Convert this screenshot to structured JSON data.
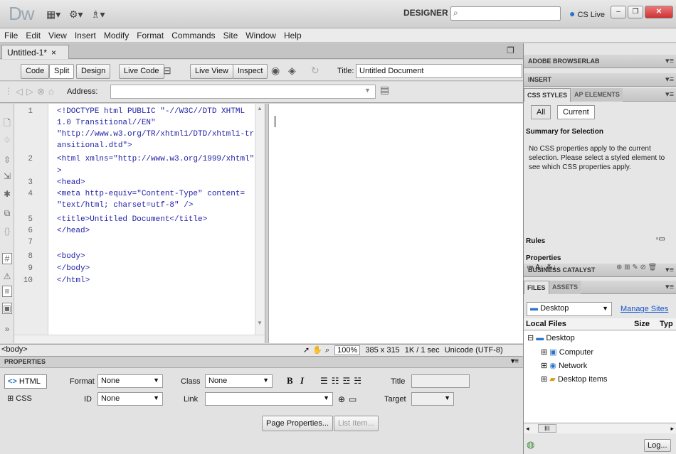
{
  "app": {
    "logo": "Dw",
    "workspace": "DESIGNER ▾",
    "cslive": "CS Live",
    "search_placeholder": "",
    "toolbar_icons": [
      "▦▾",
      "⚙▾",
      "♗▾"
    ]
  },
  "window_controls": {
    "minimize": "–",
    "maximize": "❐",
    "close": "✕"
  },
  "menu": [
    "File",
    "Edit",
    "View",
    "Insert",
    "Modify",
    "Format",
    "Commands",
    "Site",
    "Window",
    "Help"
  ],
  "document_tab": {
    "label": "Untitled-1*",
    "close": "×"
  },
  "view_buttons": {
    "code": "Code",
    "split": "Split",
    "design": "Design",
    "live_code": "Live Code",
    "live_view": "Live View",
    "inspect": "Inspect"
  },
  "title_field": {
    "label": "Title:",
    "value": "Untitled Document"
  },
  "address": {
    "label": "Address:",
    "value": ""
  },
  "code_lines": [
    {
      "num": "1",
      "text": "<!DOCTYPE html PUBLIC \"-//W3C//DTD XHTML"
    },
    {
      "num": "",
      "text": "1.0 Transitional//EN\""
    },
    {
      "num": "",
      "text": "\"http://www.w3.org/TR/xhtml1/DTD/xhtml1-tr"
    },
    {
      "num": "",
      "text": "ansitional.dtd\">"
    },
    {
      "num": "2",
      "text": "<html xmlns=\"http://www.w3.org/1999/xhtml\""
    },
    {
      "num": "",
      "text": ">"
    },
    {
      "num": "3",
      "text": "<head>"
    },
    {
      "num": "4",
      "text": "<meta http-equiv=\"Content-Type\" content="
    },
    {
      "num": "",
      "text": "\"text/html; charset=utf-8\" />"
    },
    {
      "num": "5",
      "text": "<title>Untitled Document</title>"
    },
    {
      "num": "6",
      "text": "</head>"
    },
    {
      "num": "7",
      "text": ""
    },
    {
      "num": "8",
      "text": "<body>"
    },
    {
      "num": "9",
      "text": "</body>"
    },
    {
      "num": "10",
      "text": "</html>"
    }
  ],
  "status": {
    "tag": "<body>",
    "zoom": "100%",
    "dimensions": "385 x 315",
    "download": "1K / 1 sec",
    "encoding": "Unicode (UTF-8)"
  },
  "properties": {
    "header": "PROPERTIES",
    "html_btn": "HTML",
    "css_btn": "CSS",
    "format_label": "Format",
    "format_value": "None",
    "id_label": "ID",
    "id_value": "None",
    "class_label": "Class",
    "class_value": "None",
    "link_label": "Link",
    "bold": "B",
    "italic": "I",
    "title_label": "Title",
    "target_label": "Target",
    "page_properties": "Page Properties...",
    "list_item": "List Item..."
  },
  "panels": {
    "browserlab": "ADOBE BROWSERLAB",
    "insert": "INSERT",
    "css_styles_tab": "CSS STYLES",
    "ap_elements_tab": "AP ELEMENTS",
    "all_btn": "All",
    "current_btn": "Current",
    "summary_header": "Summary for Selection",
    "summary_text": "No CSS properties apply to the current selection. Please select a styled element to see which CSS properties apply.",
    "rules": "Rules",
    "properties": "Properties",
    "business_catalyst": "BUSINESS CATALYST",
    "files_tab": "FILES",
    "assets_tab": "ASSETS",
    "site": "Desktop",
    "manage_sites": "Manage Sites",
    "local_files": "Local Files",
    "size_col": "Size",
    "type_col": "Typ",
    "tree": [
      "Desktop",
      "Computer",
      "Network",
      "Desktop items"
    ],
    "log_btn": "Log...",
    "scroll_label": "III"
  },
  "colors": {
    "accent": "#2b74c7",
    "code_text": "#1f1fa8",
    "link": "#1155cc"
  }
}
